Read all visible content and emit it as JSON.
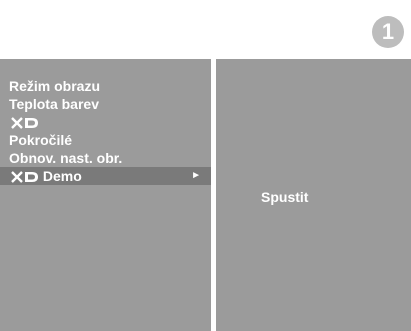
{
  "step_badge": "1",
  "menu": {
    "items": [
      {
        "label": "Režim obrazu"
      },
      {
        "label": "Teplota barev"
      },
      {
        "logo": "XD",
        "label": ""
      },
      {
        "label": "Pokročilé"
      },
      {
        "label": "Obnov. nast. obr."
      },
      {
        "logo": "XD",
        "label": "Demo",
        "selected": true,
        "arrow": "►"
      }
    ]
  },
  "submenu": {
    "option": "Spustit"
  },
  "colors": {
    "panel": "#9b9b9b",
    "selected": "#7a7a7a",
    "badge": "#bdbdbd",
    "text": "#ffffff"
  },
  "icons": {
    "xd_logo": "xd-logo-icon",
    "arrow": "play-arrow-icon"
  }
}
